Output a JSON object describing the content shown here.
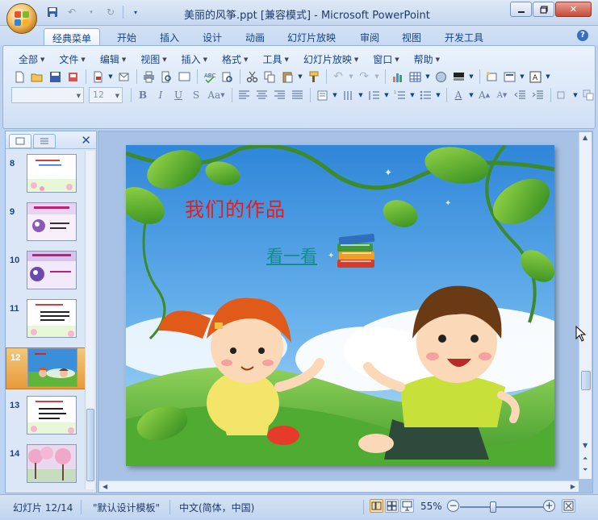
{
  "window": {
    "title": "美丽的风筝.ppt [兼容模式] - Microsoft PowerPoint"
  },
  "ribbon_tabs": [
    {
      "label": "经典菜单",
      "active": true
    },
    {
      "label": "开始"
    },
    {
      "label": "插入"
    },
    {
      "label": "设计"
    },
    {
      "label": "动画"
    },
    {
      "label": "幻灯片放映"
    },
    {
      "label": "审阅"
    },
    {
      "label": "视图"
    },
    {
      "label": "开发工具"
    }
  ],
  "menus": [
    "全部",
    "文件",
    "编辑",
    "视图",
    "插入",
    "格式",
    "工具",
    "幻灯片放映",
    "窗口",
    "帮助"
  ],
  "font_size_value": "12",
  "thumbnails": [
    {
      "num": "8"
    },
    {
      "num": "9"
    },
    {
      "num": "10"
    },
    {
      "num": "11"
    },
    {
      "num": "12",
      "selected": true
    },
    {
      "num": "13"
    },
    {
      "num": "14"
    }
  ],
  "slide": {
    "title": "我们的作品",
    "link_text": "看一看"
  },
  "status": {
    "slide_info": "幻灯片 12/14",
    "template": "\"默认设计模板\"",
    "language": "中文(简体，中国)",
    "zoom": "55%",
    "zoom_fraction": 0.38
  },
  "colors": {
    "slide_title": "#e41c1c",
    "link": "#168b8b",
    "selected_thumb": "#e79a3a"
  }
}
